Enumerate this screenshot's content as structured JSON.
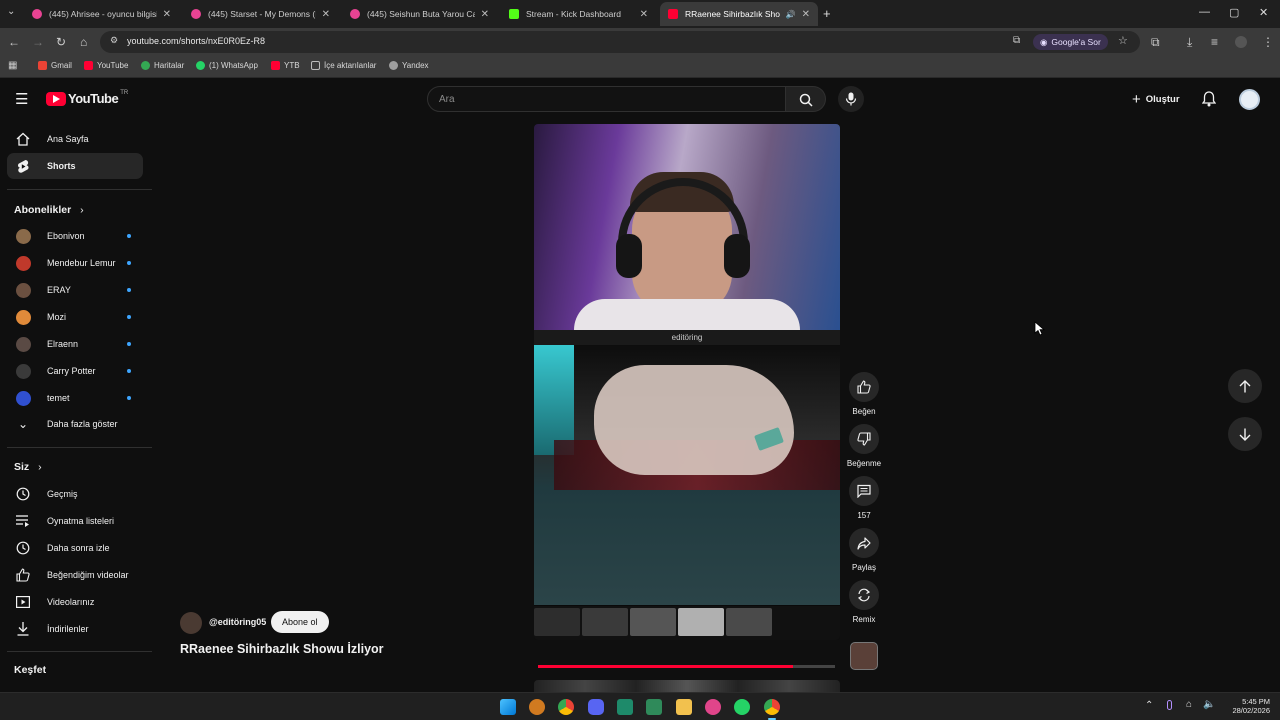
{
  "browser": {
    "tabs": [
      {
        "title": "(445) Ahrisee - oyuncu bilgisi | o",
        "active": false,
        "color": "#e84393"
      },
      {
        "title": "(445) Starset - My Demons (Nig",
        "active": false,
        "color": "#e84393"
      },
      {
        "title": "(445) Seishun Buta Yarou Cast",
        "active": false,
        "color": "#e84393"
      },
      {
        "title": "Stream - Kick Dashboard",
        "active": false,
        "color": "#53fc18"
      },
      {
        "title": "RRaenee Sihirbazlık Showu",
        "active": true,
        "color": "#ff0033"
      }
    ],
    "url": "youtube.com/shorts/nxE0R0Ez-R8",
    "google_sor": "Google'a Sor",
    "bookmarks": [
      {
        "label": "Gmail",
        "color": "#ea4335"
      },
      {
        "label": "YouTube",
        "color": "#ff0033"
      },
      {
        "label": "Haritalar",
        "color": "#34a853"
      },
      {
        "label": "(1) WhatsApp",
        "color": "#25d366"
      },
      {
        "label": "YTB",
        "color": "#ff0033"
      },
      {
        "label": "İçe aktarılanlar",
        "color": "#9e9e9e"
      },
      {
        "label": "Yandex",
        "color": "#9e9e9e"
      }
    ]
  },
  "youtube": {
    "logo": "YouTube",
    "logo_region": "TR",
    "search_placeholder": "Ara",
    "create_label": "Oluştur",
    "sidebar": {
      "top": [
        {
          "label": "Ana Sayfa",
          "icon": "home-icon",
          "selected": false
        },
        {
          "label": "Shorts",
          "icon": "shorts-icon",
          "selected": true
        }
      ],
      "subs_title": "Abonelikler",
      "subs": [
        {
          "label": "Ebonivon",
          "color": "#8a6a4a"
        },
        {
          "label": "Mendebur Lemur",
          "color": "#c0392b"
        },
        {
          "label": "ERAY",
          "color": "#6b5040"
        },
        {
          "label": "Mozi",
          "color": "#e08a3a"
        },
        {
          "label": "Elraenn",
          "color": "#5a4a44"
        },
        {
          "label": "Carry Potter",
          "color": "#3a3a3a"
        },
        {
          "label": "temet",
          "color": "#3050d0"
        }
      ],
      "show_more": "Daha fazla göster",
      "you_title": "Siz",
      "you": [
        {
          "label": "Geçmiş",
          "icon": "history-icon"
        },
        {
          "label": "Oynatma listeleri",
          "icon": "playlists-icon"
        },
        {
          "label": "Daha sonra izle",
          "icon": "watch-later-icon"
        },
        {
          "label": "Beğendiğim videolar",
          "icon": "liked-icon"
        },
        {
          "label": "Videolarınız",
          "icon": "your-videos-icon"
        },
        {
          "label": "İndirilenler",
          "icon": "downloads-icon"
        }
      ],
      "explore_title": "Keşfet"
    },
    "short": {
      "overlay_caption": "editöring",
      "channel": "@editöring05",
      "subscribe": "Abone ol",
      "title": "RRaenee Sihirbazlık Showu İzliyor",
      "progress": 0.86,
      "actions": {
        "like": "Beğen",
        "dislike": "Beğenme",
        "comments": "157",
        "share": "Paylaş",
        "remix": "Remix"
      }
    }
  },
  "taskbar": {
    "time": "5:45 PM",
    "date": "28/02/2026"
  }
}
